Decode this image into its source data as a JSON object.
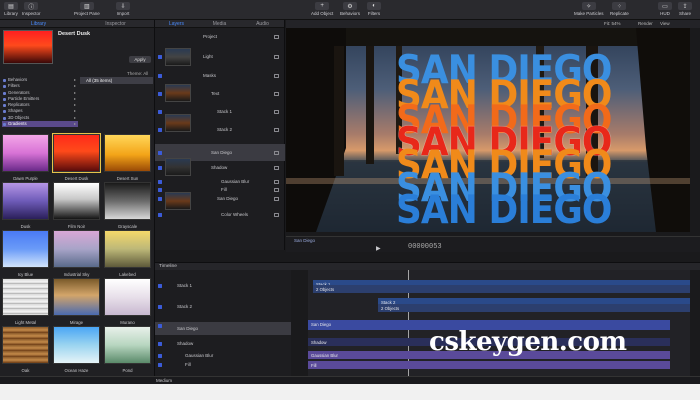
{
  "toolbar": {
    "left": [
      {
        "label": "Library",
        "icon": "library-icon"
      },
      {
        "label": "Inspector",
        "icon": "inspector-icon"
      },
      {
        "label": "Project Pane",
        "icon": "project-pane-icon"
      },
      {
        "label": "Import",
        "icon": "import-icon"
      }
    ],
    "center": [
      {
        "label": "Add Object",
        "icon": "add-object-icon"
      },
      {
        "label": "Behaviors",
        "icon": "behaviors-icon"
      },
      {
        "label": "Filters",
        "icon": "filters-icon"
      }
    ],
    "right": [
      {
        "label": "Make Particles",
        "icon": "make-particles-icon"
      },
      {
        "label": "Replicate",
        "icon": "replicate-icon"
      },
      {
        "label": "HUD",
        "icon": "hud-icon"
      },
      {
        "label": "Share",
        "icon": "share-icon"
      }
    ]
  },
  "library": {
    "tabs": [
      "Library",
      "Inspector"
    ],
    "preset_name": "Desert Dusk",
    "apply_label": "Apply",
    "theme_label": "Theme: All",
    "categories": [
      "Behaviors",
      "Filters",
      "Generators",
      "Particle Emitters",
      "Replicators",
      "Shapes",
      "3D Objects",
      "Gradients"
    ],
    "selected_category": "Gradients",
    "all_item": "All (35 items)",
    "swatches": [
      {
        "label": "Dawn Purple",
        "gradient": "linear-gradient(180deg,#f3a6e8,#d873d6 50%,#6a2a8a)"
      },
      {
        "label": "Desert Dusk",
        "gradient": "linear-gradient(180deg,#ff2a1a,#ff4a1a 45%,#5a0b0b)"
      },
      {
        "label": "Desert Sun",
        "gradient": "linear-gradient(180deg,#ffd75a,#f3a418 55%,#9a4a06)"
      },
      {
        "label": "Dusk",
        "gradient": "linear-gradient(180deg,#b696e6,#6e5bb8 50%,#2a1f5a)"
      },
      {
        "label": "Film Noir",
        "gradient": "linear-gradient(180deg,#ffffff,#c8c8c8 45%,#151515)"
      },
      {
        "label": "Grayscale",
        "gradient": "linear-gradient(180deg,#1a1a1a,#6a6a6a 50%,#d8d8d8)"
      },
      {
        "label": "Icy Blue",
        "gradient": "linear-gradient(180deg,#4a7af5,#6a9bf8 50%,#d2e4fb)"
      },
      {
        "label": "Industrial Sky",
        "gradient": "linear-gradient(180deg,#d8a7d6,#a8a4c8 50%,#5a6a8a)"
      },
      {
        "label": "Lakebed",
        "gradient": "linear-gradient(180deg,#f5d86a,#bdb878 50%,#5e5a3a)"
      },
      {
        "label": "Light Metal",
        "gradient": "repeating-linear-gradient(180deg,#d9d9d9 0,#f4f4f4 3px,#a8a8a8 5px)"
      },
      {
        "label": "Mirage",
        "gradient": "linear-gradient(180deg,#7a5a2a,#d3a56a 45%,#4a6ab0)"
      },
      {
        "label": "Murano",
        "gradient": "linear-gradient(180deg,#ffffff,#e8e0ea 50%,#c8b8d0)"
      },
      {
        "label": "Oak",
        "gradient": "repeating-linear-gradient(180deg,#8a5a2a 0,#c48a4a 3px,#6a3a14 6px)"
      },
      {
        "label": "Ocean Haze",
        "gradient": "linear-gradient(180deg,#4aa6f5,#9ad4f0 50%,#e6f4f8)"
      },
      {
        "label": "Pond",
        "gradient": "linear-gradient(180deg,#e8f0ea,#b8d6c0 50%,#5a8a6a)"
      }
    ]
  },
  "layers": {
    "tabs": [
      "Layers",
      "Media",
      "Audio"
    ],
    "rows": [
      {
        "name": "Project",
        "type": "project"
      },
      {
        "name": "Light",
        "type": "light"
      },
      {
        "name": "Masks",
        "type": "group"
      },
      {
        "name": "Text",
        "type": "group"
      },
      {
        "name": "Stack 1",
        "type": "item"
      },
      {
        "name": "Stack 2",
        "type": "item"
      },
      {
        "name": "San Diego",
        "type": "item"
      },
      {
        "name": "Shadow",
        "type": "group"
      },
      {
        "name": "Gaussian Blur",
        "type": "filter"
      },
      {
        "name": "Fill",
        "type": "filter"
      },
      {
        "name": "San Diego",
        "type": "item"
      },
      {
        "name": "Color Wheels",
        "type": "filter"
      }
    ],
    "thumb_texts": [
      "SAN DIEGO",
      "SAN DIEGO"
    ]
  },
  "canvas": {
    "fit_label": "Fit: 54%",
    "render_label": "Render",
    "view_label": "View",
    "lines": [
      {
        "text": "SAN DIEGO",
        "color": "#3a8fe0"
      },
      {
        "text": "SAN DIEGO",
        "color": "#f08a1a"
      },
      {
        "text": "SAN DIEGO",
        "color": "#f26a1a"
      },
      {
        "text": "SAN DIEGO",
        "color": "#e8281a"
      },
      {
        "text": "SAN DIEGO",
        "color": "#f08a1a"
      },
      {
        "text": "SAN DIEGO",
        "color": "#3a8fe0"
      },
      {
        "text": "SAN DIEGO",
        "color": "#2a7ed8"
      }
    ],
    "mini_label": "San Diego"
  },
  "transport": {
    "timecode": "00000053"
  },
  "timeline": {
    "title": "Timeline",
    "rows": [
      {
        "name": "Stack 1"
      },
      {
        "name": "Stack 2"
      },
      {
        "name": "San Diego"
      },
      {
        "name": "Shadow"
      },
      {
        "name": "Gaussian Blur"
      },
      {
        "name": "Fill"
      }
    ],
    "bars": [
      {
        "label": "Stack 1",
        "color": "#2a4a8a"
      },
      {
        "label": "2 Objects",
        "color": "#2c3f6e"
      },
      {
        "label": "Stack 2",
        "color": "#2a4a8a"
      },
      {
        "label": "2 Objects",
        "color": "#2c3f6e"
      },
      {
        "label": "San Diego",
        "color": "#3a4aa0"
      },
      {
        "label": "Shadow",
        "color": "#2a2f5a"
      },
      {
        "label": "Gaussian Blur",
        "color": "#5a4a9a"
      },
      {
        "label": "Fill",
        "color": "#5a4a9a"
      }
    ]
  },
  "bottom": {
    "size_label": "Medium"
  },
  "watermark": "cskeygen.com"
}
